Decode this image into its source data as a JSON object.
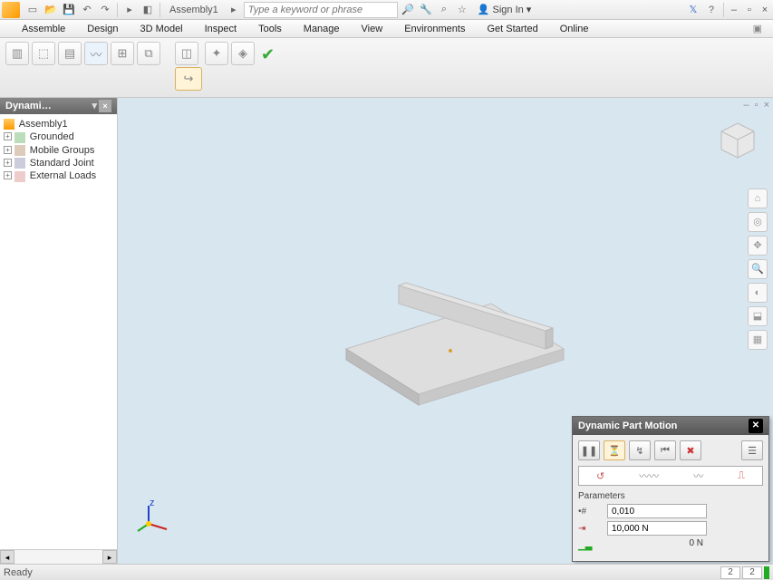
{
  "titlebar": {
    "doc_label": "Assembly1",
    "search_placeholder": "Type a keyword or phrase",
    "signin_label": "Sign In"
  },
  "menubar": {
    "items": [
      "Assemble",
      "Design",
      "3D Model",
      "Inspect",
      "Tools",
      "Manage",
      "View",
      "Environments",
      "Get Started",
      "Online"
    ]
  },
  "sidepanel": {
    "title": "Dynami…",
    "tree": {
      "root": "Assembly1",
      "children": [
        "Grounded",
        "Mobile Groups",
        "Standard Joint",
        "External Loads"
      ]
    }
  },
  "float_panel": {
    "title": "Dynamic Part Motion",
    "params_label": "Parameters",
    "step_value": "0,010",
    "force_value": "10,000 N",
    "readout_value": "0 N"
  },
  "statusbar": {
    "status": "Ready",
    "val1": "2",
    "val2": "2"
  }
}
